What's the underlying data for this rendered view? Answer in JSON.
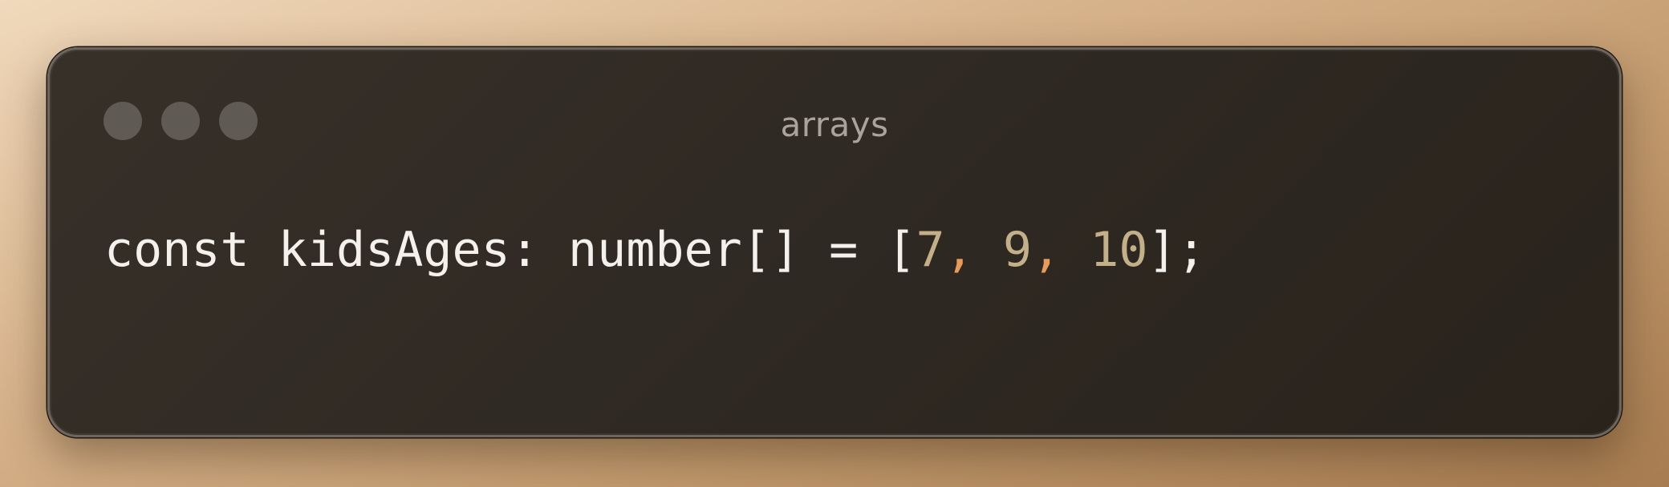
{
  "window": {
    "title": "arrays"
  },
  "traffic_lights": [
    "close",
    "minimize",
    "maximize"
  ],
  "colors": {
    "code_text": "#f4f1ec",
    "number": "#c4b088",
    "comma": "#e79a5a",
    "title": "#a9a39b",
    "window_bg": "#322c25"
  },
  "code": {
    "line1": {
      "prefix": "const kidsAges: number[] = [",
      "n1": "7",
      "c1": ",",
      "n2": " 9",
      "c2": ",",
      "n3": " 10",
      "suffix": "];"
    }
  }
}
